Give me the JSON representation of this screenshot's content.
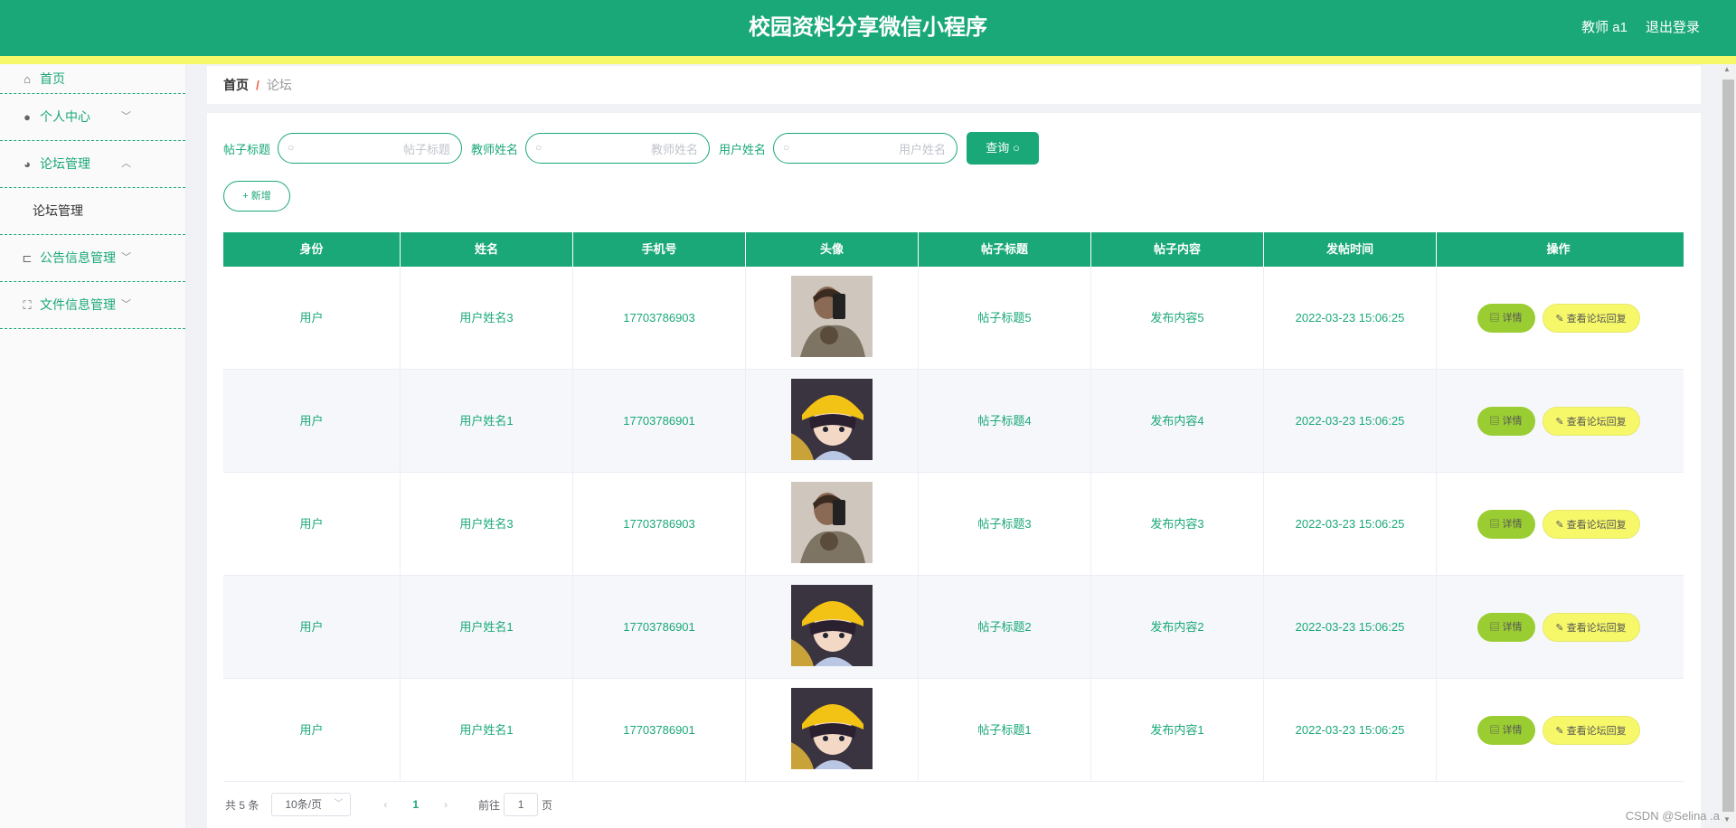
{
  "header": {
    "title": "校园资料分享微信小程序",
    "user": "教师 a1",
    "logout": "退出登录"
  },
  "sidebar": {
    "items": [
      {
        "label": "首页",
        "icon": "home-icon"
      },
      {
        "label": "个人中心",
        "icon": "user-icon"
      },
      {
        "label": "论坛管理",
        "icon": "pin-icon"
      },
      {
        "label": "论坛管理",
        "sub": true
      },
      {
        "label": "公告信息管理",
        "icon": "crop-icon"
      },
      {
        "label": "文件信息管理",
        "icon": "fullscreen-icon"
      }
    ]
  },
  "breadcrumb": {
    "home": "首页",
    "sep": "/",
    "current": "论坛"
  },
  "filters": [
    {
      "label": "帖子标题",
      "placeholder": "帖子标题"
    },
    {
      "label": "教师姓名",
      "placeholder": "教师姓名"
    },
    {
      "label": "用户姓名",
      "placeholder": "用户姓名"
    }
  ],
  "query_label": "查询",
  "add_label": "新增",
  "table": {
    "columns": [
      "身份",
      "姓名",
      "手机号",
      "头像",
      "帖子标题",
      "帖子内容",
      "发帖时间",
      "操作"
    ],
    "rows": [
      {
        "role": "用户",
        "name": "用户姓名3",
        "phone": "17703786903",
        "avatar": "man-photo",
        "title": "帖子标题5",
        "content": "发布内容5",
        "time": "2022-03-23 15:06:25"
      },
      {
        "role": "用户",
        "name": "用户姓名1",
        "phone": "17703786901",
        "avatar": "cartoon-girl",
        "title": "帖子标题4",
        "content": "发布内容4",
        "time": "2022-03-23 15:06:25"
      },
      {
        "role": "用户",
        "name": "用户姓名3",
        "phone": "17703786903",
        "avatar": "man-photo",
        "title": "帖子标题3",
        "content": "发布内容3",
        "time": "2022-03-23 15:06:25"
      },
      {
        "role": "用户",
        "name": "用户姓名1",
        "phone": "17703786901",
        "avatar": "cartoon-girl",
        "title": "帖子标题2",
        "content": "发布内容2",
        "time": "2022-03-23 15:06:25"
      },
      {
        "role": "用户",
        "name": "用户姓名1",
        "phone": "17703786901",
        "avatar": "cartoon-girl",
        "title": "帖子标题1",
        "content": "发布内容1",
        "time": "2022-03-23 15:06:25"
      }
    ],
    "detail_label": "详情",
    "reply_label": "查看论坛回复"
  },
  "pagination": {
    "total": "共 5 条",
    "page_size": "10条/页",
    "current": "1",
    "goto_prefix": "前往",
    "goto_value": "1",
    "goto_suffix": "页"
  },
  "watermark": "CSDN @Selina .a",
  "colors": {
    "primary": "#1aa878",
    "accent_yellow": "#f6f86a",
    "detail_green": "#9acd32"
  }
}
